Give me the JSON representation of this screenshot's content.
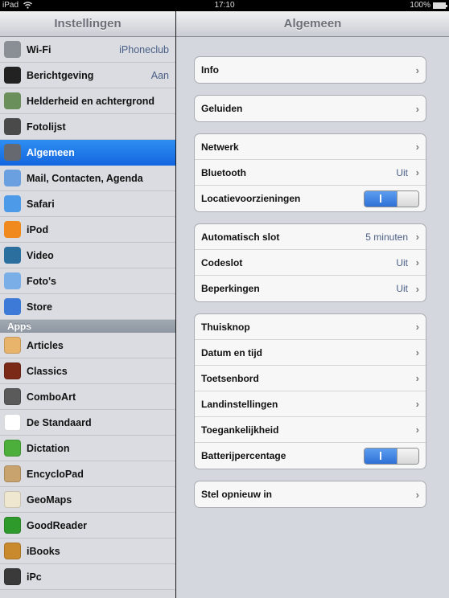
{
  "status_bar": {
    "device": "iPad",
    "time": "17:10",
    "battery": "100%"
  },
  "sidebar": {
    "title": "Instellingen",
    "items": [
      {
        "label": "Wi-Fi",
        "value": "iPhoneclub",
        "icon": "wifi-icon",
        "color": "#8a8e95"
      },
      {
        "label": "Berichtgeving",
        "value": "Aan",
        "icon": "notifications-icon",
        "color": "#222222"
      },
      {
        "label": "Helderheid en achtergrond",
        "value": "",
        "icon": "brightness-wallpaper-icon",
        "color": "#6a8f5a"
      },
      {
        "label": "Fotolijst",
        "value": "",
        "icon": "picture-frame-icon",
        "color": "#4a4a4a"
      },
      {
        "label": "Algemeen",
        "value": "",
        "icon": "general-gear-icon",
        "color": "#666a70",
        "selected": true
      },
      {
        "label": "Mail, Contacten, Agenda",
        "value": "",
        "icon": "mail-icon",
        "color": "#6a9fe0"
      },
      {
        "label": "Safari",
        "value": "",
        "icon": "safari-compass-icon",
        "color": "#4d9be8"
      },
      {
        "label": "iPod",
        "value": "",
        "icon": "ipod-icon",
        "color": "#f08a1e"
      },
      {
        "label": "Video",
        "value": "",
        "icon": "video-clapper-icon",
        "color": "#2b6f9f"
      },
      {
        "label": "Foto's",
        "value": "",
        "icon": "photos-sunflower-icon",
        "color": "#79aee6"
      },
      {
        "label": "Store",
        "value": "",
        "icon": "app-store-icon",
        "color": "#3d7ad8"
      }
    ],
    "apps_header": "Apps",
    "apps": [
      {
        "label": "Articles",
        "icon": "articles-app-icon",
        "color": "#e8b36a"
      },
      {
        "label": "Classics",
        "icon": "classics-app-icon",
        "color": "#7a2a16"
      },
      {
        "label": "ComboArt",
        "icon": "comboart-app-icon",
        "color": "#5a5a5a"
      },
      {
        "label": "De Standaard",
        "icon": "de-standaard-app-icon",
        "color": "#ffffff"
      },
      {
        "label": "Dictation",
        "icon": "dictation-app-icon",
        "color": "#4caf3c"
      },
      {
        "label": "EncycloPad",
        "icon": "encyclopad-app-icon",
        "color": "#c8a36d"
      },
      {
        "label": "GeoMaps",
        "icon": "geomaps-app-icon",
        "color": "#efe7cf"
      },
      {
        "label": "GoodReader",
        "icon": "goodreader-app-icon",
        "color": "#2f9a2c"
      },
      {
        "label": "iBooks",
        "icon": "ibooks-app-icon",
        "color": "#c98a2e"
      },
      {
        "label": "iPc",
        "icon": "ipc-app-icon",
        "color": "#3a3a3a"
      }
    ]
  },
  "detail": {
    "title": "Algemeen",
    "groups": [
      [
        {
          "label": "Info",
          "value": "",
          "type": "disclosure"
        }
      ],
      [
        {
          "label": "Geluiden",
          "value": "",
          "type": "disclosure"
        }
      ],
      [
        {
          "label": "Netwerk",
          "value": "",
          "type": "disclosure"
        },
        {
          "label": "Bluetooth",
          "value": "Uit",
          "type": "disclosure"
        },
        {
          "label": "Locatievoorzieningen",
          "value": "on",
          "type": "toggle"
        }
      ],
      [
        {
          "label": "Automatisch slot",
          "value": "5 minuten",
          "type": "disclosure"
        },
        {
          "label": "Codeslot",
          "value": "Uit",
          "type": "disclosure"
        },
        {
          "label": "Beperkingen",
          "value": "Uit",
          "type": "disclosure"
        }
      ],
      [
        {
          "label": "Thuisknop",
          "value": "",
          "type": "disclosure"
        },
        {
          "label": "Datum en tijd",
          "value": "",
          "type": "disclosure"
        },
        {
          "label": "Toetsenbord",
          "value": "",
          "type": "disclosure"
        },
        {
          "label": "Landinstellingen",
          "value": "",
          "type": "disclosure"
        },
        {
          "label": "Toegankelijkheid",
          "value": "",
          "type": "disclosure"
        },
        {
          "label": "Batterijpercentage",
          "value": "on",
          "type": "toggle"
        }
      ],
      [
        {
          "label": "Stel opnieuw in",
          "value": "",
          "type": "disclosure"
        }
      ]
    ]
  },
  "colors": {
    "selection": "#1f7be8",
    "value_text": "#4b5f86",
    "toggle_on": "#3a7ee0"
  },
  "glyphs": {
    "chevron": "›"
  }
}
